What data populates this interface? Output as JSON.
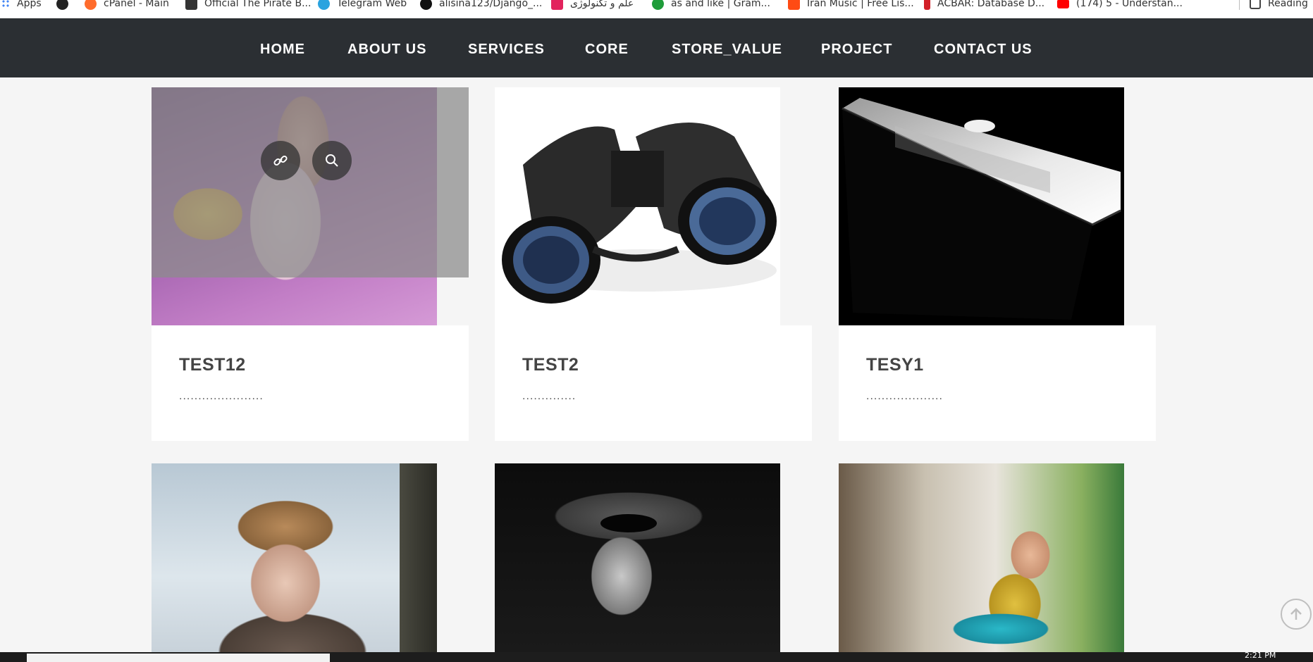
{
  "bookmarks": [
    {
      "label": "Apps",
      "icon": "apps-grid-icon"
    },
    {
      "label": "",
      "icon": "globe-icon"
    },
    {
      "label": "cPanel - Main",
      "icon": "cpanel-icon"
    },
    {
      "label": "Official The Pirate B...",
      "icon": "pirate-ship-icon"
    },
    {
      "label": "Telegram Web",
      "icon": "telegram-icon"
    },
    {
      "label": "alisina123/Django_...",
      "icon": "github-icon"
    },
    {
      "label": "علم و تکنولوژی",
      "icon": "dice-icon"
    },
    {
      "label": "as  and  like  | Gram...",
      "icon": "clover-icon"
    },
    {
      "label": "Iran Music | Free Lis...",
      "icon": "music-icon"
    },
    {
      "label": "ACBAR: Database D...",
      "icon": "acbar-icon"
    },
    {
      "label": "(174) 5 - Understan...",
      "icon": "youtube-icon"
    },
    {
      "label": "Reading",
      "icon": "reading-list-icon"
    }
  ],
  "nav": {
    "items": [
      "HOME",
      "ABOUT US",
      "SERVICES",
      "CORE",
      "STORE_VALUE",
      "PROJECT",
      "CONTACT US"
    ]
  },
  "portfolio": {
    "cards": [
      {
        "title": "TEST12",
        "desc": "......................",
        "image": "woman-in-sweater-photo"
      },
      {
        "title": "TEST2",
        "desc": "..............",
        "image": "binoculars-photo"
      },
      {
        "title": "TESY1",
        "desc": "....................",
        "image": "laptop-photo"
      }
    ],
    "row2_images": [
      "woman-fur-hat-photo",
      "woman-hat-sunglasses-photo",
      "woman-guitar-photo"
    ]
  },
  "overlay": {
    "link_icon": "link-icon",
    "zoom_icon": "search-icon"
  },
  "taskbar": {
    "time": "2:21 PM"
  },
  "colors": {
    "nav_bg": "#2b2f33",
    "page_bg": "#f5f5f5",
    "card_bg": "#ffffff"
  }
}
